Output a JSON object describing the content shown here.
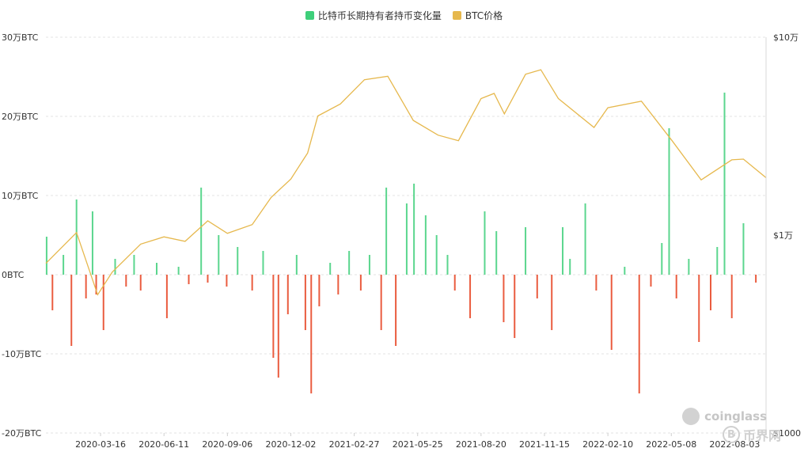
{
  "legend": [
    {
      "label": "比特币长期持有者持币变化量",
      "color": "#3ecf7a"
    },
    {
      "label": "BTC价格",
      "color": "#e6b84d"
    }
  ],
  "watermark": {
    "brand": "coinglass",
    "brand2": "币界网",
    "brand2_icon": "B"
  },
  "chart_data": {
    "type": "bar+line",
    "x_tick_labels": [
      "2020-03-16",
      "2020-06-11",
      "2020-09-06",
      "2020-12-02",
      "2021-02-27",
      "2021-05-25",
      "2021-08-20",
      "2021-11-15",
      "2022-02-10",
      "2022-05-08",
      "2022-08-03"
    ],
    "x_range": [
      "2020-01-01",
      "2022-09-15"
    ],
    "y_left": {
      "ticks": [
        "30万BTC",
        "20万BTC",
        "10万BTC",
        "0BTC",
        "-10万BTC",
        "-20万BTC"
      ],
      "range": [
        -200000,
        300000
      ]
    },
    "y_right": {
      "ticks": [
        "$10万",
        "$1万",
        "$1000"
      ],
      "scale": "log",
      "range": [
        1000,
        100000
      ]
    },
    "series": [
      {
        "name": "比特币长期持有者持币变化量",
        "type": "bar",
        "positive_color": "#3ecf7a",
        "negative_color": "#e84a2a",
        "points": [
          [
            "2020-01-02",
            48000
          ],
          [
            "2020-01-10",
            -45000
          ],
          [
            "2020-01-25",
            25000
          ],
          [
            "2020-02-05",
            -90000
          ],
          [
            "2020-02-12",
            95000
          ],
          [
            "2020-02-25",
            -30000
          ],
          [
            "2020-03-05",
            80000
          ],
          [
            "2020-03-10",
            -25000
          ],
          [
            "2020-03-20",
            -70000
          ],
          [
            "2020-04-05",
            20000
          ],
          [
            "2020-04-20",
            -15000
          ],
          [
            "2020-05-01",
            25000
          ],
          [
            "2020-05-10",
            -20000
          ],
          [
            "2020-06-01",
            15000
          ],
          [
            "2020-06-15",
            -55000
          ],
          [
            "2020-07-01",
            10000
          ],
          [
            "2020-07-15",
            -12000
          ],
          [
            "2020-08-01",
            110000
          ],
          [
            "2020-08-10",
            -10000
          ],
          [
            "2020-08-25",
            50000
          ],
          [
            "2020-09-05",
            -15000
          ],
          [
            "2020-09-20",
            35000
          ],
          [
            "2020-10-10",
            -20000
          ],
          [
            "2020-10-25",
            30000
          ],
          [
            "2020-11-08",
            -105000
          ],
          [
            "2020-11-15",
            -130000
          ],
          [
            "2020-11-28",
            -50000
          ],
          [
            "2020-12-10",
            25000
          ],
          [
            "2020-12-22",
            -70000
          ],
          [
            "2020-12-30",
            -150000
          ],
          [
            "2021-01-10",
            -40000
          ],
          [
            "2021-01-25",
            15000
          ],
          [
            "2021-02-05",
            -25000
          ],
          [
            "2021-02-20",
            30000
          ],
          [
            "2021-03-08",
            -20000
          ],
          [
            "2021-03-20",
            25000
          ],
          [
            "2021-04-05",
            -70000
          ],
          [
            "2021-04-12",
            110000
          ],
          [
            "2021-04-25",
            -90000
          ],
          [
            "2021-05-10",
            90000
          ],
          [
            "2021-05-20",
            115000
          ],
          [
            "2021-06-05",
            75000
          ],
          [
            "2021-06-20",
            50000
          ],
          [
            "2021-07-05",
            25000
          ],
          [
            "2021-07-15",
            -20000
          ],
          [
            "2021-08-05",
            -55000
          ],
          [
            "2021-08-25",
            80000
          ],
          [
            "2021-09-10",
            55000
          ],
          [
            "2021-09-20",
            -60000
          ],
          [
            "2021-10-05",
            -80000
          ],
          [
            "2021-10-20",
            60000
          ],
          [
            "2021-11-05",
            -30000
          ],
          [
            "2021-11-25",
            -70000
          ],
          [
            "2021-12-10",
            60000
          ],
          [
            "2021-12-20",
            20000
          ],
          [
            "2022-01-10",
            90000
          ],
          [
            "2022-01-25",
            -20000
          ],
          [
            "2022-02-15",
            -95000
          ],
          [
            "2022-03-05",
            10000
          ],
          [
            "2022-03-25",
            -150000
          ],
          [
            "2022-04-10",
            -15000
          ],
          [
            "2022-04-25",
            40000
          ],
          [
            "2022-05-05",
            185000
          ],
          [
            "2022-05-15",
            -30000
          ],
          [
            "2022-06-01",
            20000
          ],
          [
            "2022-06-15",
            -85000
          ],
          [
            "2022-07-01",
            -45000
          ],
          [
            "2022-07-10",
            35000
          ],
          [
            "2022-07-20",
            230000
          ],
          [
            "2022-07-30",
            -55000
          ],
          [
            "2022-08-15",
            65000
          ],
          [
            "2022-09-01",
            -10000
          ]
        ]
      },
      {
        "name": "BTC价格",
        "type": "line",
        "axis": "right",
        "color": "#e6b84d",
        "points": [
          [
            "2020-01-01",
            7200
          ],
          [
            "2020-02-12",
            10300
          ],
          [
            "2020-03-12",
            5000
          ],
          [
            "2020-04-01",
            6500
          ],
          [
            "2020-05-10",
            9000
          ],
          [
            "2020-06-11",
            9800
          ],
          [
            "2020-07-10",
            9300
          ],
          [
            "2020-08-10",
            11800
          ],
          [
            "2020-09-06",
            10200
          ],
          [
            "2020-10-10",
            11300
          ],
          [
            "2020-11-05",
            15500
          ],
          [
            "2020-12-02",
            19200
          ],
          [
            "2020-12-25",
            26000
          ],
          [
            "2021-01-08",
            40000
          ],
          [
            "2021-02-08",
            46000
          ],
          [
            "2021-03-13",
            61000
          ],
          [
            "2021-04-14",
            63500
          ],
          [
            "2021-05-19",
            38000
          ],
          [
            "2021-06-22",
            32000
          ],
          [
            "2021-07-20",
            30000
          ],
          [
            "2021-08-20",
            49000
          ],
          [
            "2021-09-07",
            52000
          ],
          [
            "2021-09-21",
            41000
          ],
          [
            "2021-10-20",
            65000
          ],
          [
            "2021-11-10",
            68500
          ],
          [
            "2021-12-04",
            49000
          ],
          [
            "2022-01-22",
            35000
          ],
          [
            "2022-02-10",
            44000
          ],
          [
            "2022-03-28",
            47500
          ],
          [
            "2022-05-09",
            30000
          ],
          [
            "2022-06-18",
            19000
          ],
          [
            "2022-07-30",
            24000
          ],
          [
            "2022-08-15",
            24200
          ],
          [
            "2022-09-15",
            19500
          ]
        ]
      }
    ],
    "grid": true,
    "legend_position": "top-center"
  }
}
